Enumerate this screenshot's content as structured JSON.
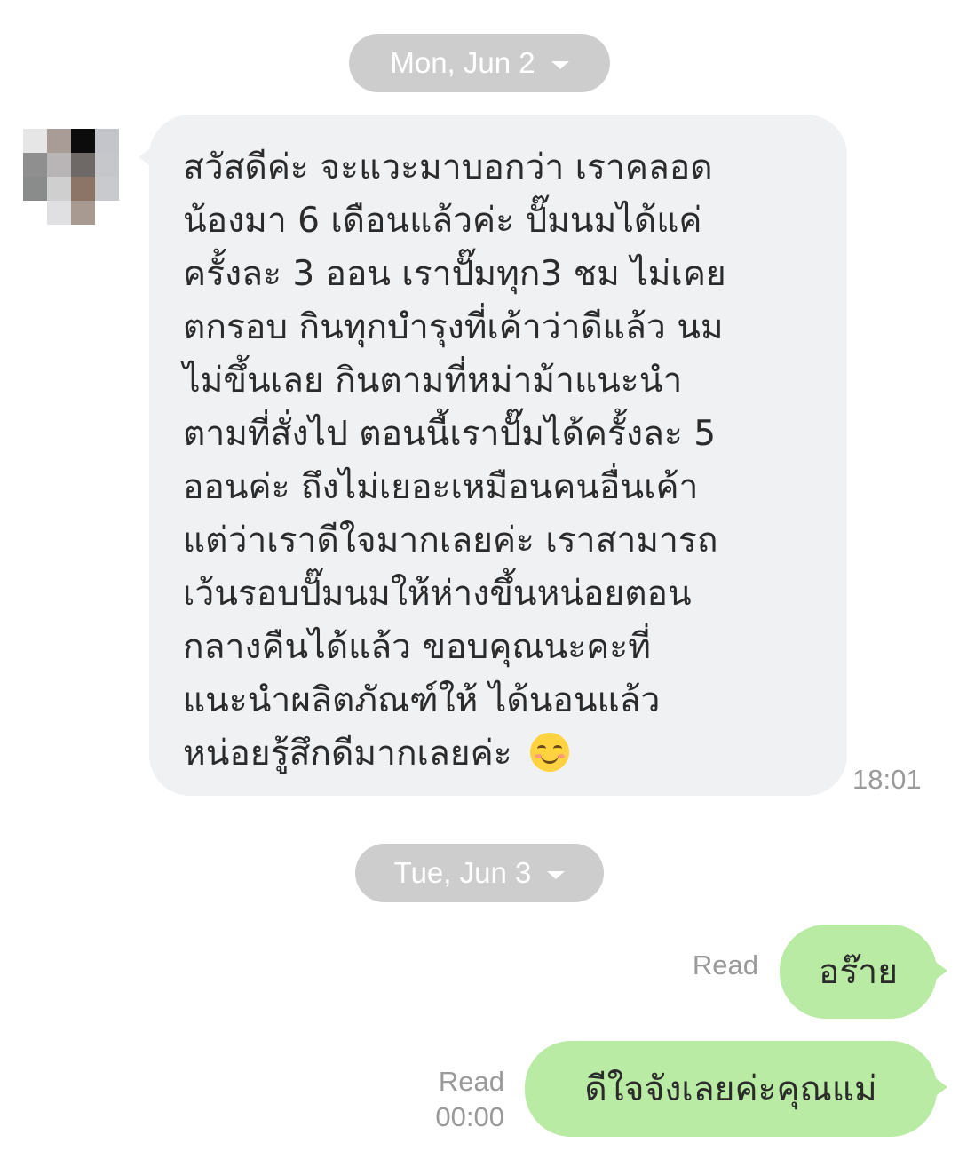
{
  "dates": [
    "Mon, Jun 2",
    "Tue, Jun 3"
  ],
  "incoming": {
    "text": "สวัสดีค่ะ จะแวะมาบอกว่า เราคลอด\nน้องมา 6 เดือนแล้วค่ะ ปั๊มนมได้แค่\nครั้งละ 3 ออน เราปั๊มทุก3 ชม ไม่เคย\nตกรอบ กินทุกบำรุงที่เค้าว่าดีแล้ว นม\nไม่ขึ้นเลย กินตามที่หม่าม้าแนะนำ\nตามที่สั่งไป ตอนนี้เราปั๊มได้ครั้งละ 5\nออนค่ะ ถึงไม่เยอะเหมือนคนอื่นเค้า\nแต่ว่าเราดีใจมากเลยค่ะ เราสามารถ\nเว้นรอบปั๊มนมให้ห่างขึ้นหน่อยตอน\nกลางคืนได้แล้ว ขอบคุณนะคะที่\nแนะนำผลิตภัณฑ์ให้ ได้นอนแล้ว\nหน่อยรู้สึกดีมากเลยค่ะ",
    "emoji": "smiling-face-icon",
    "time": "18:01"
  },
  "outgoing": [
    {
      "text": "อร๊าย",
      "status": "Read",
      "time": ""
    },
    {
      "text": "ดีใจจังเลยค่ะคุณแม่",
      "status": "Read",
      "time": "00:00"
    }
  ],
  "colors": {
    "incoming_bubble": "#f0f1f3",
    "outgoing_bubble": "#b9eba4",
    "date_pill": "#cdcdcd",
    "meta_text": "#9a9a9a"
  }
}
